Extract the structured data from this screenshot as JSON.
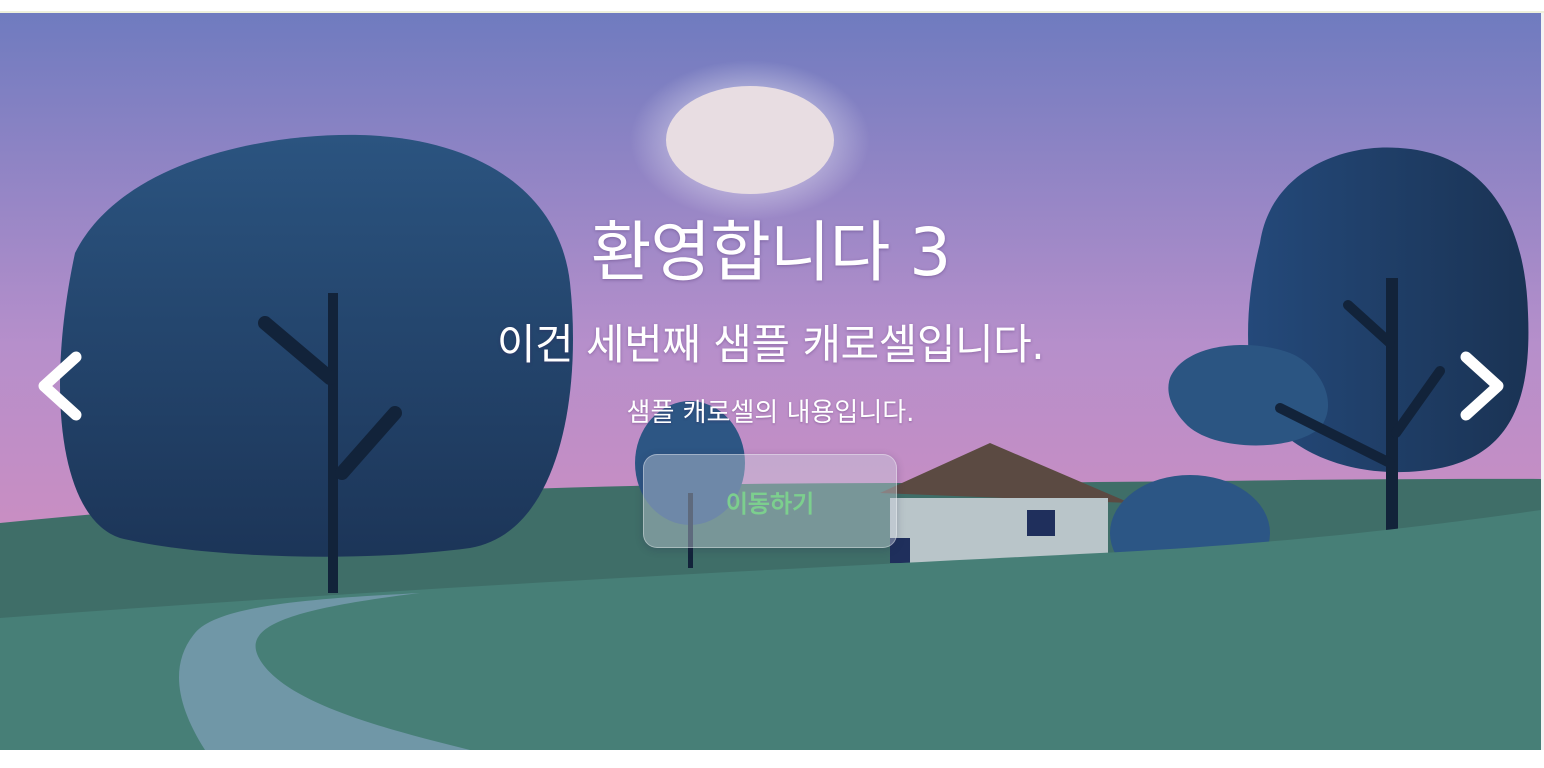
{
  "carousel": {
    "slide": {
      "title": "환영합니다 3",
      "subtitle": "이건 세번째 샘플 캐로셀입니다.",
      "description": "샘플 캐로셀의 내용입니다.",
      "button_label": "이동하기"
    },
    "prev_icon": "chevron-left-icon",
    "next_icon": "chevron-right-icon",
    "colors": {
      "sky_top": "#6f7bbf",
      "sky_bottom": "#e08cb8",
      "moon": "#e8dde2",
      "tree": "#23476f",
      "hill": "#477f77",
      "path": "#7097a7",
      "button_text": "#7ccf8e"
    }
  }
}
